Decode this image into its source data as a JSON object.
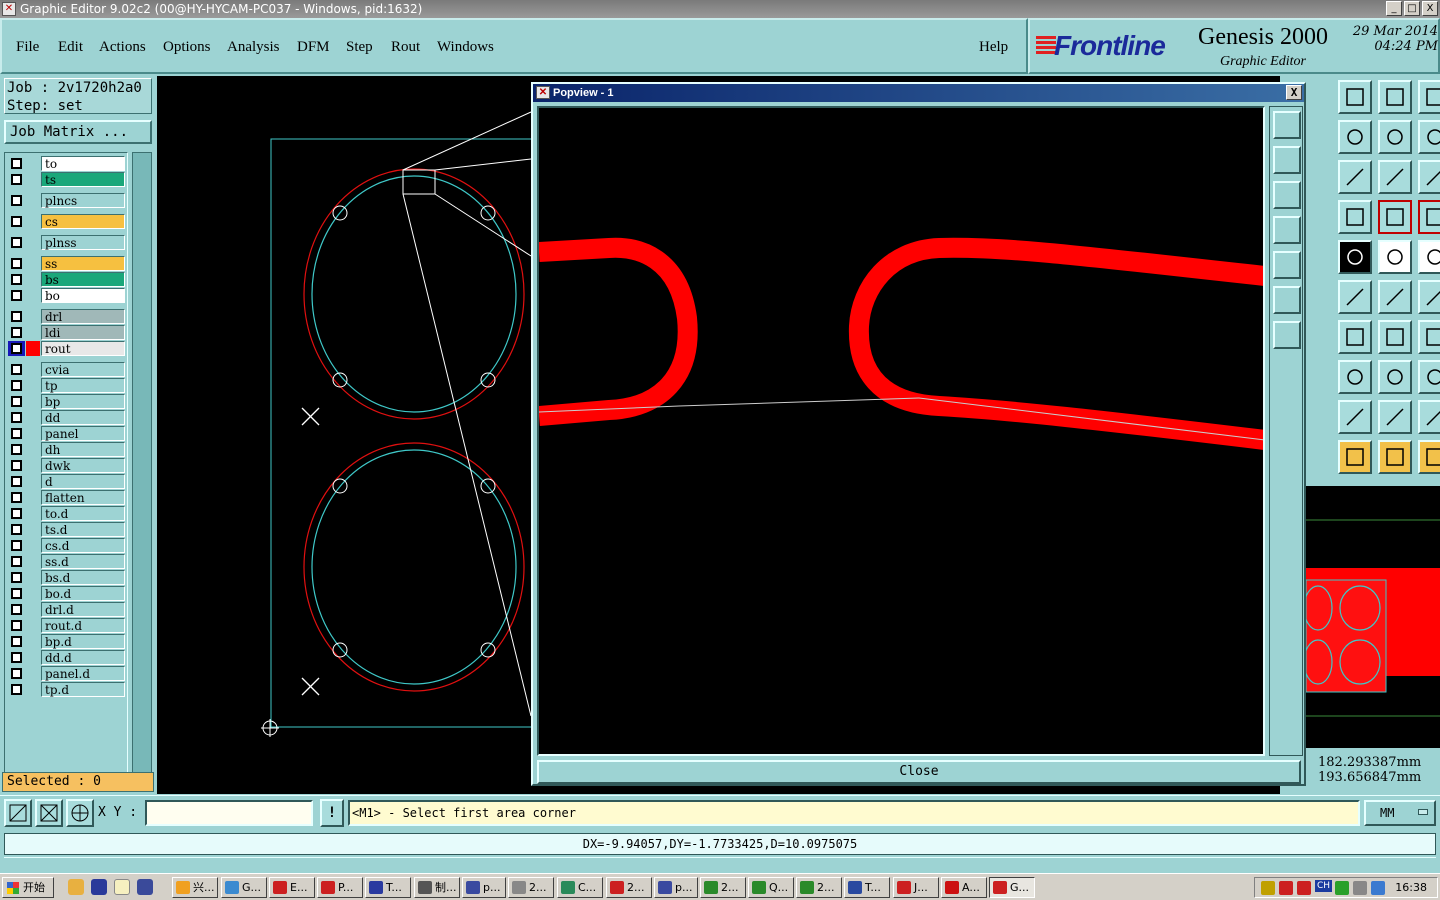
{
  "window": {
    "title": "Graphic Editor 9.02c2 (00@HY-HYCAM-PC037 - Windows, pid:1632)",
    "controls": [
      "_",
      "□",
      "X"
    ]
  },
  "menu": {
    "items": [
      "File",
      "Edit",
      "Actions",
      "Options",
      "Analysis",
      "DFM",
      "Step",
      "Rout",
      "Windows"
    ],
    "help": "Help"
  },
  "brand": {
    "logo": "Frontline",
    "product": "Genesis 2000",
    "subtitle": "Graphic Editor",
    "date": "29 Mar 2014",
    "time": "04:24 PM"
  },
  "job": {
    "job_line": "Job : 2v1720h2a0",
    "step_line": "Step: set",
    "matrix_button": "Job Matrix ..."
  },
  "layers": [
    {
      "name": "to",
      "color": "#ffffff"
    },
    {
      "name": "ts",
      "color": "#1aa77a"
    },
    {
      "name": "plncs",
      "color": "#9dd3d3"
    },
    {
      "name": "cs",
      "color": "#f6c040"
    },
    {
      "name": "plnss",
      "color": "#9dd3d3"
    },
    {
      "name": "ss",
      "color": "#f6c040"
    },
    {
      "name": "bs",
      "color": "#1aa77a"
    },
    {
      "name": "bo",
      "color": "#ffffff"
    },
    {
      "name": "drl",
      "color": "#a0b8b8"
    },
    {
      "name": "ldi",
      "color": "#a0b8b8"
    },
    {
      "name": "rout",
      "color": "#e8e8e8",
      "active": true
    },
    {
      "name": "cvia",
      "color": "#9dd3d3"
    },
    {
      "name": "tp",
      "color": "#9dd3d3"
    },
    {
      "name": "bp",
      "color": "#9dd3d3"
    },
    {
      "name": "dd",
      "color": "#9dd3d3"
    },
    {
      "name": "panel",
      "color": "#9dd3d3"
    },
    {
      "name": "dh",
      "color": "#9dd3d3"
    },
    {
      "name": "dwk",
      "color": "#9dd3d3"
    },
    {
      "name": "d",
      "color": "#9dd3d3"
    },
    {
      "name": "flatten",
      "color": "#9dd3d3"
    },
    {
      "name": "to.d",
      "color": "#9dd3d3"
    },
    {
      "name": "ts.d",
      "color": "#9dd3d3"
    },
    {
      "name": "cs.d",
      "color": "#9dd3d3"
    },
    {
      "name": "ss.d",
      "color": "#9dd3d3"
    },
    {
      "name": "bs.d",
      "color": "#9dd3d3"
    },
    {
      "name": "bo.d",
      "color": "#9dd3d3"
    },
    {
      "name": "drl.d",
      "color": "#9dd3d3"
    },
    {
      "name": "rout.d",
      "color": "#9dd3d3"
    },
    {
      "name": "bp.d",
      "color": "#9dd3d3"
    },
    {
      "name": "dd.d",
      "color": "#9dd3d3"
    },
    {
      "name": "panel.d",
      "color": "#9dd3d3"
    },
    {
      "name": "tp.d",
      "color": "#9dd3d3"
    }
  ],
  "selected": "Selected : 0",
  "popview": {
    "title": "Popview - 1",
    "close_button": "Close",
    "close_x": "X"
  },
  "coords": {
    "x": "182.293387mm",
    "y": "193.656847mm"
  },
  "command": {
    "xy_label": "X Y :",
    "xy_value": "",
    "warn": "!",
    "prompt": "<M1> - Select first area corner",
    "units": "MM"
  },
  "status": {
    "measure": "DX=-9.94057,DY=-1.7733425,D=10.0975075"
  },
  "taskbar": {
    "start": "开始",
    "tasks": [
      "兴...",
      "G...",
      "E...",
      "P...",
      "T...",
      "制...",
      "p...",
      "2...",
      "C...",
      "2...",
      "p...",
      "2...",
      "Q...",
      "2...",
      "T...",
      "J...",
      "A...",
      "G..."
    ],
    "tray_lang": "CH",
    "clock": "16:38"
  },
  "colors": {
    "panel": "#9dd3d3",
    "rout": "#ff0000",
    "outline": "#3fc8c8",
    "selected": "#f6c060"
  }
}
